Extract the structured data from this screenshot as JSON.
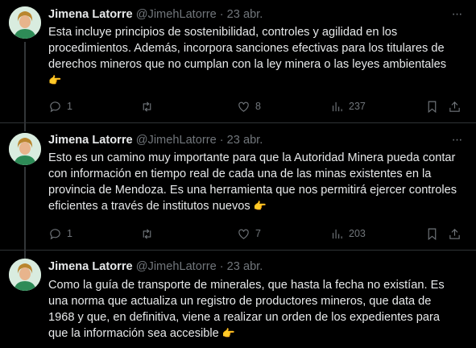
{
  "tweets": [
    {
      "name": "Jimena Latorre",
      "handle": "@JimehLatorre",
      "date": "· 23 abr.",
      "text": "Esta incluye principios de sostenibilidad, controles y agilidad en los procedimientos. Además, incorpora sanciones efectivas para los titulares de derechos mineros que no cumplan con la ley minera o las leyes ambientales",
      "emoji": "👉",
      "replies": "1",
      "retweets": "",
      "likes": "8",
      "views": "237"
    },
    {
      "name": "Jimena Latorre",
      "handle": "@JimehLatorre",
      "date": "· 23 abr.",
      "text": "Esto es un camino muy importante para que la Autoridad Minera pueda contar con información en tiempo real de cada una de las minas existentes en la provincia de Mendoza. Es una herramienta que nos permitirá ejercer controles eficientes a través de institutos nuevos",
      "emoji": "👉",
      "replies": "1",
      "retweets": "",
      "likes": "7",
      "views": "203"
    },
    {
      "name": "Jimena Latorre",
      "handle": "@JimehLatorre",
      "date": "· 23 abr.",
      "text": "Como la guía de transporte de minerales, que hasta la fecha no existían. Es una norma que actualiza un registro de productores mineros, que data de 1968 y que, en definitiva, viene a realizar un orden de los expedientes para que la información sea accesible",
      "emoji": "👉",
      "replies": "",
      "retweets": "",
      "likes": "",
      "views": ""
    }
  ],
  "more_label": "···",
  "icons": [
    "reply-icon",
    "retweet-icon",
    "like-icon",
    "views-icon",
    "bookmark-icon",
    "share-icon"
  ]
}
